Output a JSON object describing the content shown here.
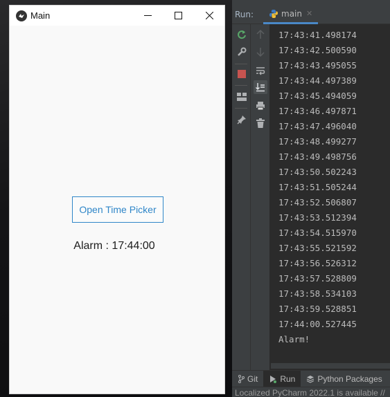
{
  "app": {
    "title": "Main",
    "open_picker_label": "Open Time Picker",
    "alarm_text": "Alarm : 17:44:00"
  },
  "ide": {
    "run_label": "Run:",
    "run_tab": "main",
    "console_lines": [
      "17:43:41.498174",
      "17:43:42.500590",
      "17:43:43.495055",
      "17:43:44.497389",
      "17:43:45.494059",
      "17:43:46.497871",
      "17:43:47.496040",
      "17:43:48.499277",
      "17:43:49.498756",
      "17:43:50.502243",
      "17:43:51.505244",
      "17:43:52.506807",
      "17:43:53.512394",
      "17:43:54.515970",
      "17:43:55.521592",
      "17:43:56.526312",
      "17:43:57.528809",
      "17:43:58.534103",
      "17:43:59.528851",
      "17:44:00.527445",
      "Alarm!"
    ],
    "bottom_tabs": {
      "git": "Git",
      "run": "Run",
      "python_packages": "Python Packages"
    },
    "status_text": "Localized PyCharm 2022.1 is available //"
  },
  "colors": {
    "accent_blue": "#2f86c8",
    "ide_bg": "#2b2b2b",
    "ide_panel": "#3c3f41",
    "console_text": "#bbbbbb"
  },
  "icons": {
    "app": "kivy-logo-icon",
    "minimize": "minimize-icon",
    "maximize": "maximize-icon",
    "close": "close-icon",
    "rerun": "rerun-icon",
    "settings": "wrench-icon",
    "stop": "stop-icon",
    "layout": "layout-icon",
    "pin": "pin-icon",
    "up": "arrow-up-icon",
    "down": "arrow-down-icon",
    "soft_wrap": "soft-wrap-icon",
    "scroll_end": "scroll-to-end-icon",
    "print": "print-icon",
    "trash": "trash-icon",
    "python": "python-icon"
  }
}
